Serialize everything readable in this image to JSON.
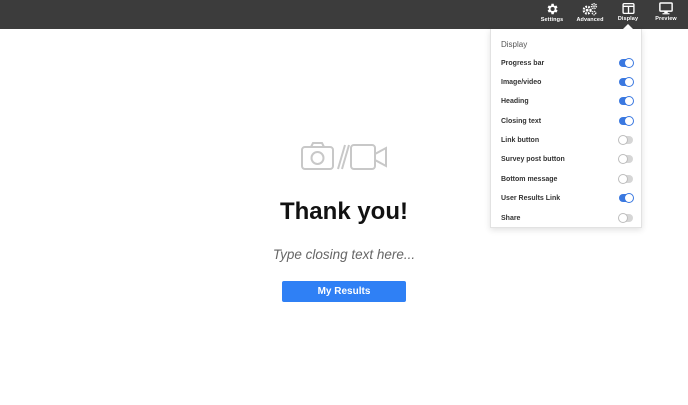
{
  "toolbar": {
    "settings_label": "Settings",
    "advanced_label": "Advanced",
    "display_label": "Display",
    "preview_label": "Preview"
  },
  "page": {
    "title": "Thank you!",
    "closing_text": "Type closing text here...",
    "results_button": "My Results"
  },
  "display_panel": {
    "title": "Display",
    "items": [
      {
        "label": "Progress bar",
        "enabled": true
      },
      {
        "label": "Image/video",
        "enabled": true
      },
      {
        "label": "Heading",
        "enabled": true
      },
      {
        "label": "Closing text",
        "enabled": true
      },
      {
        "label": "Link button",
        "enabled": false
      },
      {
        "label": "Survey post button",
        "enabled": false
      },
      {
        "label": "Bottom message",
        "enabled": false
      },
      {
        "label": "User Results Link",
        "enabled": true
      },
      {
        "label": "Share",
        "enabled": false
      }
    ]
  },
  "colors": {
    "topbar": "#3c3c3c",
    "accent": "#2f80f5",
    "toggle_on": "#3a78e0",
    "toggle_off": "#d6d6d6"
  }
}
